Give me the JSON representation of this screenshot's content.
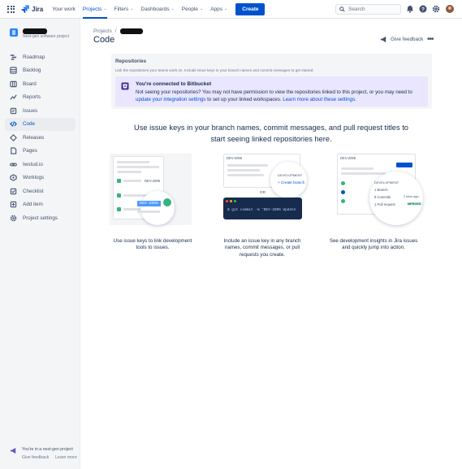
{
  "topnav": {
    "product": "Jira",
    "items": [
      {
        "label": "Your work",
        "chevron": false,
        "active": false
      },
      {
        "label": "Projects",
        "chevron": true,
        "active": true
      },
      {
        "label": "Filters",
        "chevron": true,
        "active": false
      },
      {
        "label": "Dashboards",
        "chevron": true,
        "active": false
      },
      {
        "label": "People",
        "chevron": true,
        "active": false
      },
      {
        "label": "Apps",
        "chevron": true,
        "active": false
      }
    ],
    "create_label": "Create",
    "search_placeholder": "Search",
    "icons": [
      "apps-grid-icon",
      "jira-logo-icon",
      "search-icon",
      "notifications-icon",
      "help-icon",
      "settings-icon",
      "profile-avatar"
    ],
    "accent": "#0052cc"
  },
  "sidebar": {
    "project_type": "Next-gen software project",
    "items": [
      {
        "label": "Roadmap",
        "icon": "roadmap-icon",
        "active": false
      },
      {
        "label": "Backlog",
        "icon": "backlog-icon",
        "active": false
      },
      {
        "label": "Board",
        "icon": "board-icon",
        "active": false
      },
      {
        "label": "Reports",
        "icon": "reports-icon",
        "active": false
      },
      {
        "label": "Issues",
        "icon": "issues-icon",
        "active": false
      },
      {
        "label": "Code",
        "icon": "code-icon",
        "active": true
      },
      {
        "label": "Releases",
        "icon": "releases-icon",
        "active": false
      },
      {
        "label": "Pages",
        "icon": "pages-icon",
        "active": false
      },
      {
        "label": "Iwstud.io",
        "icon": "link-icon",
        "active": false
      },
      {
        "label": "Worklogs",
        "icon": "worklogs-icon",
        "active": false
      },
      {
        "label": "Checklist",
        "icon": "checklist-icon",
        "active": false
      },
      {
        "label": "Add item",
        "icon": "add-item-icon",
        "active": false
      },
      {
        "label": "Project settings",
        "icon": "settings-icon",
        "active": false
      }
    ],
    "footer": {
      "text": "You're in a next-gen project",
      "give_feedback": "Give feedback",
      "learn_more": "Learn more"
    }
  },
  "main": {
    "breadcrumb_projects": "Projects",
    "breadcrumb_sep": "/",
    "title": "Code",
    "give_feedback": "Give feedback",
    "more_label": "•••",
    "repositories": {
      "title": "Repositories",
      "subtitle": "Link the repositories your teams work on. Include issue keys in your branch names and commit messages to get started.",
      "connected_title": "You're connected to Bitbucket",
      "connected_body_1": "Not seeing your repositories? You may not have permission to view the repositories linked to this project, or you may need to",
      "connected_link_1": "update your integration settings",
      "connected_body_2": "to set up your linked workspaces.",
      "connected_link_2": "Learn more about these settings."
    },
    "headline": "Use issue keys in your branch names, commit messages, and pull request titles to start seeing linked repositories here.",
    "illustrations": [
      {
        "caption": "Use issue keys to link development tools to issues.",
        "labels": {
          "card_key": "DEV-2095",
          "badge_key": "DEV-2095"
        }
      },
      {
        "caption": "Include an issue key in any branch names, commit messages, or pull requests you create.",
        "labels": {
          "card_key": "DEV-2095",
          "development": "DEVELOPMENT",
          "create_branch": "Create branch",
          "or": "OR",
          "terminal": "$ git commit -m \"DEV-2095 Update"
        }
      },
      {
        "caption": "See development insights in Jira issues and quickly jump into action.",
        "labels": {
          "card_key": "DEV-2095",
          "development": "DEVELOPMENT",
          "branch": "1 Branch",
          "commits": "9 Commits",
          "time": "2 mins ago",
          "pull_request": "1 Pull request",
          "status": "MERGED"
        }
      }
    ]
  }
}
